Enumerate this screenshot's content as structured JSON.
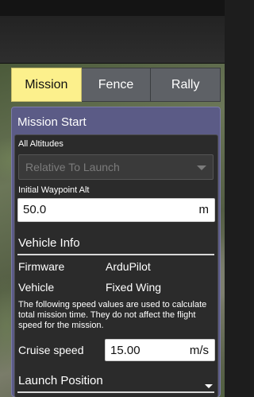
{
  "tabs": [
    {
      "label": "Mission",
      "active": true
    },
    {
      "label": "Fence",
      "active": false
    },
    {
      "label": "Rally",
      "active": false
    }
  ],
  "panel": {
    "title": "Mission Start",
    "all_altitudes_label": "All Altitudes",
    "altitude_mode": "Relative To Launch",
    "initial_wp_alt_label": "Initial Waypoint Alt",
    "initial_wp_alt_value": "50.0",
    "initial_wp_alt_unit": "m",
    "vehicle_info_title": "Vehicle Info",
    "firmware_label": "Firmware",
    "firmware_value": "ArduPilot",
    "vehicle_label": "Vehicle",
    "vehicle_value": "Fixed Wing",
    "speed_note": "The following speed values are used to calculate total mission time. They do not affect the flight speed for the mission.",
    "cruise_speed_label": "Cruise speed",
    "cruise_speed_value": "15.00",
    "cruise_speed_unit": "m/s",
    "launch_position_title": "Launch Position"
  },
  "colors": {
    "active_tab": "#fcf08c",
    "inactive_tab": "#5e6166",
    "panel_bg": "#5b5b86",
    "inner_bg": "#2b2b2b"
  }
}
